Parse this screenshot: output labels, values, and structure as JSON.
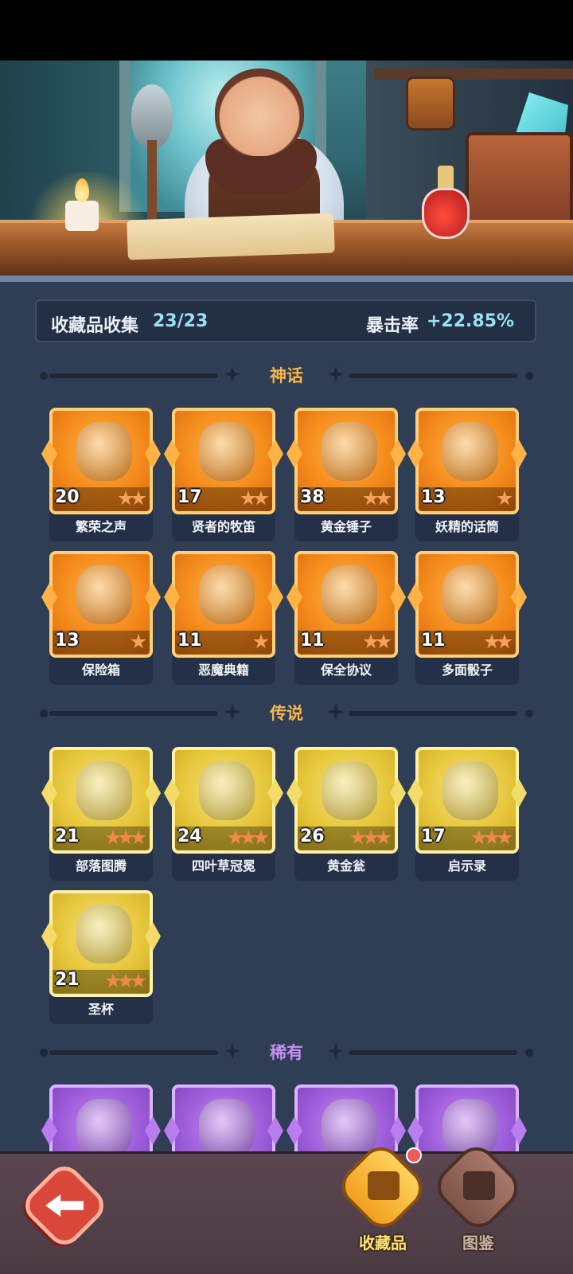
{
  "colors": {
    "accent_cyan": "#9ae1ee",
    "mythic": "#f48a1a",
    "legendary": "#e6c63a",
    "rare": "#9b5ad8",
    "section_title": "#f5b74b",
    "section_title_rare": "#c78ef5",
    "panel_bg": "#2f3d55"
  },
  "stats": {
    "collection_label": "收藏品收集",
    "collection_value": "23/23",
    "crit_label": "暴击率",
    "crit_value": "+22.85%"
  },
  "sections": {
    "mythic": {
      "title": "神话",
      "items": [
        {
          "name": "繁荣之声",
          "level": "20",
          "stars": 2,
          "icon": "blue-shell-icon"
        },
        {
          "name": "贤者的牧笛",
          "level": "17",
          "stars": 2,
          "icon": "white-flute-icon"
        },
        {
          "name": "黄金锤子",
          "level": "38",
          "stars": 2,
          "icon": "golden-hammer-icon"
        },
        {
          "name": "妖精的话筒",
          "level": "13",
          "stars": 1,
          "icon": "fairy-microphone-icon"
        },
        {
          "name": "保险箱",
          "level": "13",
          "stars": 1,
          "icon": "treasure-chest-icon"
        },
        {
          "name": "恶魔典籍",
          "level": "11",
          "stars": 1,
          "icon": "demon-book-icon"
        },
        {
          "name": "保全协议",
          "level": "11",
          "stars": 2,
          "icon": "contract-scroll-icon"
        },
        {
          "name": "多面骰子",
          "level": "11",
          "stars": 2,
          "icon": "polyhedral-dice-icon"
        }
      ]
    },
    "legendary": {
      "title": "传说",
      "items": [
        {
          "name": "部落图腾",
          "level": "21",
          "stars": 3,
          "icon": "tribal-totem-icon"
        },
        {
          "name": "四叶草冠冕",
          "level": "24",
          "stars": 3,
          "icon": "clover-crown-icon"
        },
        {
          "name": "黄金瓮",
          "level": "26",
          "stars": 3,
          "icon": "golden-urn-icon"
        },
        {
          "name": "启示录",
          "level": "17",
          "stars": 3,
          "icon": "open-book-icon"
        },
        {
          "name": "圣杯",
          "level": "21",
          "stars": 3,
          "icon": "holy-grail-icon"
        }
      ]
    },
    "rare": {
      "title": "稀有",
      "items": [
        {
          "icon": "thorn-vine-icon"
        },
        {
          "icon": "phoenix-feather-icon"
        },
        {
          "icon": "battle-axe-icon"
        },
        {
          "icon": "lightning-card-icon"
        }
      ]
    }
  },
  "nav": {
    "collect_label": "收藏品",
    "codex_label": "图鉴"
  }
}
